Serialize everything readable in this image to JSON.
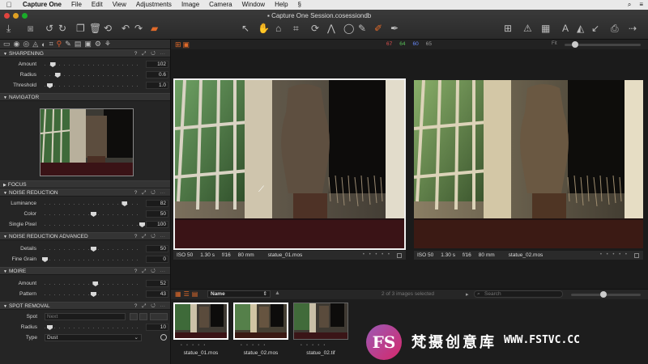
{
  "menubar": {
    "app_name": "Capture One",
    "items": [
      "File",
      "Edit",
      "View",
      "Adjustments",
      "Image",
      "Camera",
      "Window",
      "Help"
    ]
  },
  "window": {
    "title": "Capture One Session.cosessiondb"
  },
  "panels": {
    "sharpening": {
      "title": "SHARPENING",
      "sliders": [
        {
          "label": "Amount",
          "value": "102",
          "fraction": 0.08
        },
        {
          "label": "Radius",
          "value": "0.6",
          "fraction": 0.13
        },
        {
          "label": "Threshold",
          "value": "1.0",
          "fraction": 0.05
        }
      ]
    },
    "navigator": {
      "title": "NAVIGATOR"
    },
    "focus": {
      "title": "FOCUS"
    },
    "noise_reduction": {
      "title": "NOISE REDUCTION",
      "sliders": [
        {
          "label": "Luminance",
          "value": "82",
          "fraction": 0.82
        },
        {
          "label": "Color",
          "value": "50",
          "fraction": 0.5
        },
        {
          "label": "Single Pixel",
          "value": "100",
          "fraction": 1.0
        }
      ]
    },
    "noise_reduction_advanced": {
      "title": "NOISE REDUCTION ADVANCED",
      "sliders": [
        {
          "label": "Details",
          "value": "50",
          "fraction": 0.5
        },
        {
          "label": "Fine Grain",
          "value": "0",
          "fraction": 0.0
        }
      ]
    },
    "moire": {
      "title": "MOIRE",
      "sliders": [
        {
          "label": "Amount",
          "value": "52",
          "fraction": 0.52
        },
        {
          "label": "Pattern",
          "value": "43",
          "fraction": 0.5
        }
      ]
    },
    "spot_removal": {
      "title": "SPOT REMOVAL",
      "spot_label": "Spot",
      "spot_value": "Next",
      "radius_label": "Radius",
      "radius_value": "10",
      "radius_fraction": 0.05,
      "type_label": "Type",
      "type_value": "Dust"
    }
  },
  "viewer": {
    "rgb_readout": [
      {
        "value": "67",
        "color": "#e05050"
      },
      {
        "value": "64",
        "color": "#58c058"
      },
      {
        "value": "60",
        "color": "#6a8cff"
      },
      {
        "value": "65",
        "color": "#999999"
      }
    ],
    "zoom_label": "Fit",
    "images": [
      {
        "iso": "ISO 50",
        "shutter": "1.30 s",
        "aperture": "f/16",
        "focal": "80 mm",
        "file": "statue_01.mos"
      },
      {
        "iso": "ISO 50",
        "shutter": "1.30 s",
        "aperture": "f/16",
        "focal": "80 mm",
        "file": "statue_02.mos"
      }
    ],
    "rating_dots": "• • • • •"
  },
  "browser": {
    "sort_value": "Name",
    "count_text": "2 of 3 images selected",
    "search_placeholder": "Search",
    "thumbnails": [
      {
        "name": "statue_01.mos",
        "selected": true
      },
      {
        "name": "statue_02.mos",
        "selected": true
      },
      {
        "name": "statue_02.tif",
        "selected": false
      }
    ]
  },
  "watermark": {
    "badge": "FS",
    "chinese": "梵摄创意库",
    "url": "WWW.FSTVC.CC"
  },
  "colors": {
    "accent": "#e06a2a",
    "selected_border": "#ffffff",
    "panel_bg": "#252525",
    "viewer_bg": "#1b1b1b"
  },
  "icons": {
    "viewer_toolbar": [
      "single-view-icon",
      "multi-view-icon"
    ],
    "browser_toolbar": [
      "grid-view-icon",
      "list-view-icon",
      "filmstrip-icon"
    ]
  }
}
